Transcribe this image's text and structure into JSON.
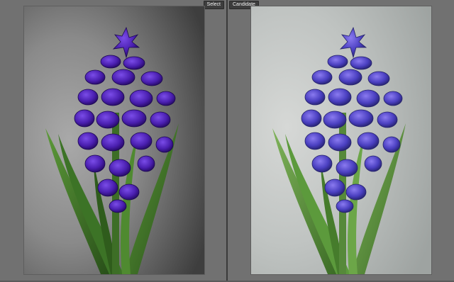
{
  "compare_view": {
    "select_label": "Select",
    "candidate_label": "Candidate"
  },
  "colors": {
    "panel_bg": "#717171",
    "divider": "#3a3a3a",
    "label_bg": "#3d3d3d",
    "label_text": "#f0f0f0",
    "flower_select": "#4a1fb0",
    "flower_candidate": "#4a3fc0",
    "leaf_green": "#3f7a2a"
  }
}
